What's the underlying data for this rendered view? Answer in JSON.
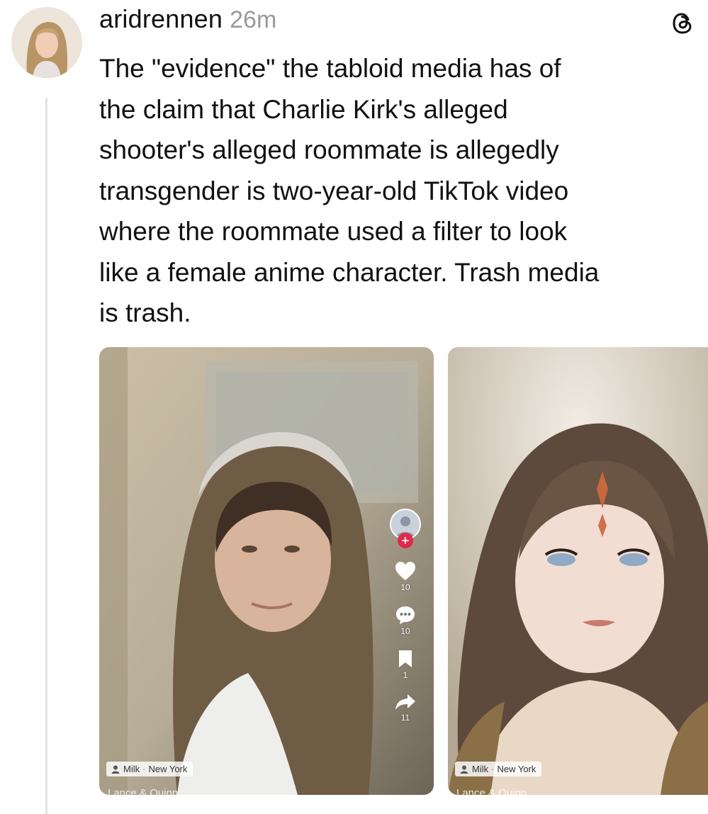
{
  "post": {
    "username": "aridrennen",
    "time": "26m",
    "text": "The \"evidence\" the tabloid media has of\nthe claim that Charlie Kirk's alleged\nshooter's alleged roommate is allegedly\ntransgender is two-year-old TikTok video\nwhere the roommate used a filter to look\nlike a female anime character. Trash media\nis trash."
  },
  "icons": {
    "threads_logo": "threads-logo-icon",
    "like": "heart-icon",
    "comment": "comment-bubble-icon",
    "save": "bookmark-icon",
    "share": "share-arrow-icon",
    "follow": "plus-icon",
    "user": "person-icon"
  },
  "media_left": {
    "likes": "10",
    "comments": "10",
    "saves": "1",
    "shares": "11",
    "tag_user": "Milk",
    "tag_separator": "·",
    "tag_location": "New York",
    "caption_fragment": "Lance & Quinn"
  },
  "media_right": {
    "tag_user": "Milk",
    "tag_separator": "·",
    "tag_location": "New York",
    "caption_fragment": "Lance & Quinn"
  },
  "colors": {
    "text": "#111111",
    "muted": "#9a9a9a",
    "follow_red": "#e0294b",
    "thread_line": "#e2e2e2"
  }
}
